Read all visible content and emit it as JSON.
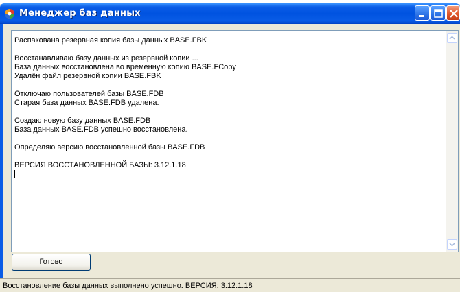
{
  "window": {
    "title": "Менеджер баз данных"
  },
  "log": {
    "lines": [
      "Распакована резервная копия базы данных BASE.FBK",
      "",
      "Восстанавливаю базу данных из резервной копии ...",
      "База данных восстановлена во временную копию BASE.FCopy",
      "Удалён файл резервной копии BASE.FBK",
      "",
      "Отключаю пользователей базы BASE.FDB",
      "Старая база данных BASE.FDB удалена.",
      "",
      "Создаю новую базу данных BASE.FDB",
      "База данных BASE.FDB успешно восстановлена.",
      "",
      "Определяю версию восстановленной базы BASE.FDB",
      "",
      "ВЕРСИЯ ВОССТАНОВЛЕННОЙ БАЗЫ: 3.12.1.18"
    ]
  },
  "buttons": {
    "ready_label": "Готово"
  },
  "status": {
    "text": "Восстановление базы данных выполнено успешно. ВЕРСИЯ: 3.12.1.18"
  },
  "colors": {
    "titlebar": "#0a5ce6",
    "close_button": "#e2572a",
    "window_face": "#ece9d8"
  },
  "icons": [
    "app-icon",
    "minimize-icon",
    "maximize-icon",
    "close-icon",
    "scroll-up-arrow-icon",
    "scroll-down-arrow-icon"
  ]
}
